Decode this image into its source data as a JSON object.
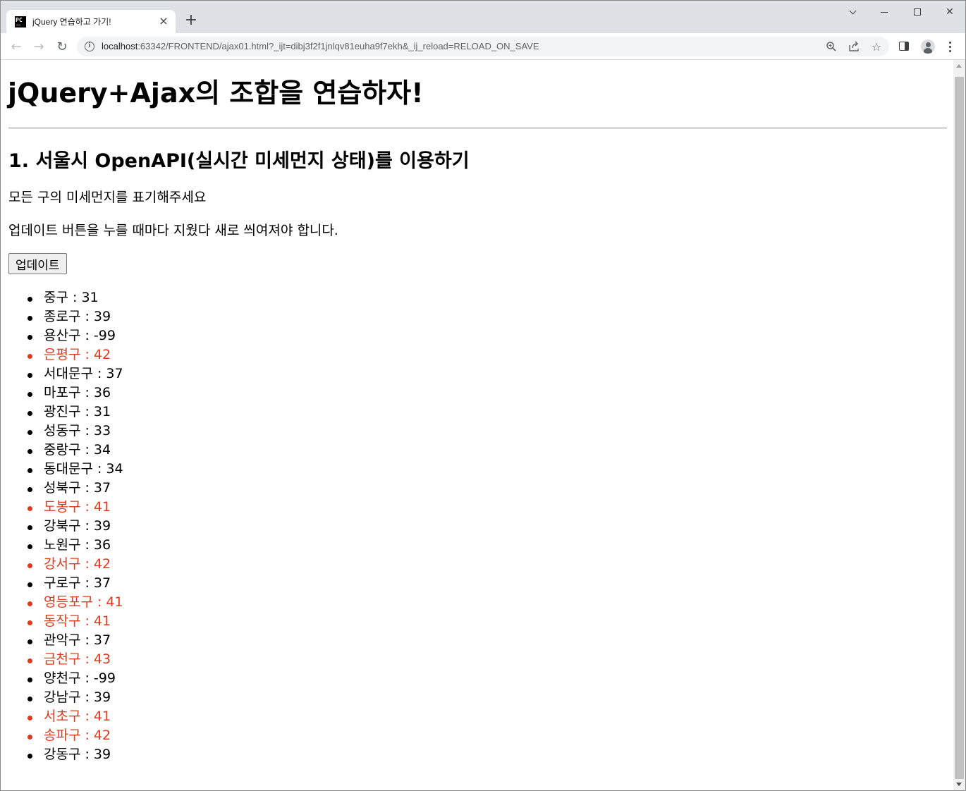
{
  "browser": {
    "tab_title": "jQuery 연습하고 가기!",
    "favicon_text": "PC",
    "url_host": "localhost",
    "url_rest": ":63342/FRONTEND/ajax01.html?_ijt=dibj3f2f1jnlqv81euha9f7ekh&_ij_reload=RELOAD_ON_SAVE"
  },
  "page": {
    "heading": "jQuery+Ajax의 조합을 연습하자!",
    "subheading": "1. 서울시 OpenAPI(실시간 미세먼지 상태)를 이용하기",
    "instruction_1": "모든 구의 미세먼지를 표기해주세요",
    "instruction_2": "업데이트 버튼을 누를 때마다 지웠다 새로 씌여져야 합니다.",
    "update_button": "업데이트"
  },
  "colors": {
    "alert_text": "#e2391e",
    "normal_text": "#000000"
  },
  "districts": [
    {
      "text": "중구 : 31",
      "alert": false
    },
    {
      "text": "종로구 : 39",
      "alert": false
    },
    {
      "text": "용산구 : -99",
      "alert": false
    },
    {
      "text": "은평구 : 42",
      "alert": true
    },
    {
      "text": "서대문구 : 37",
      "alert": false
    },
    {
      "text": "마포구 : 36",
      "alert": false
    },
    {
      "text": "광진구 : 31",
      "alert": false
    },
    {
      "text": "성동구 : 33",
      "alert": false
    },
    {
      "text": "중랑구 : 34",
      "alert": false
    },
    {
      "text": "동대문구 : 34",
      "alert": false
    },
    {
      "text": "성북구 : 37",
      "alert": false
    },
    {
      "text": "도봉구 : 41",
      "alert": true
    },
    {
      "text": "강북구 : 39",
      "alert": false
    },
    {
      "text": "노원구 : 36",
      "alert": false
    },
    {
      "text": "강서구 : 42",
      "alert": true
    },
    {
      "text": "구로구 : 37",
      "alert": false
    },
    {
      "text": "영등포구 : 41",
      "alert": true
    },
    {
      "text": "동작구 : 41",
      "alert": true
    },
    {
      "text": "관악구 : 37",
      "alert": false
    },
    {
      "text": "금천구 : 43",
      "alert": true
    },
    {
      "text": "양천구 : -99",
      "alert": false
    },
    {
      "text": "강남구 : 39",
      "alert": false
    },
    {
      "text": "서초구 : 41",
      "alert": true
    },
    {
      "text": "송파구 : 42",
      "alert": true
    },
    {
      "text": "강동구 : 39",
      "alert": false
    }
  ]
}
